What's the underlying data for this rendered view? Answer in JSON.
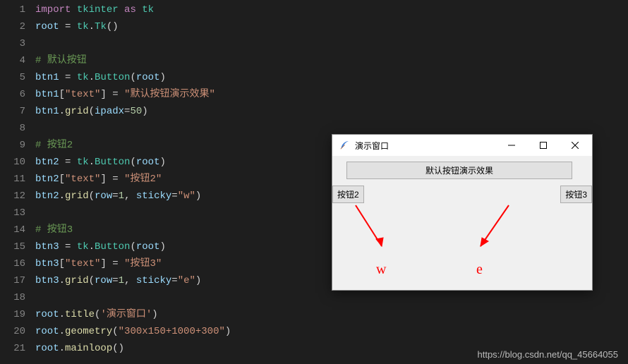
{
  "lines": [
    {
      "n": 1,
      "tokens": [
        [
          "kw",
          "import"
        ],
        [
          "op",
          " "
        ],
        [
          "mod",
          "tkinter"
        ],
        [
          "op",
          " "
        ],
        [
          "kw",
          "as"
        ],
        [
          "op",
          " "
        ],
        [
          "mod",
          "tk"
        ]
      ]
    },
    {
      "n": 2,
      "tokens": [
        [
          "var",
          "root"
        ],
        [
          "op",
          " = "
        ],
        [
          "mod",
          "tk"
        ],
        [
          "pn",
          "."
        ],
        [
          "fnc",
          "Tk"
        ],
        [
          "pn",
          "()"
        ]
      ]
    },
    {
      "n": 3,
      "tokens": []
    },
    {
      "n": 4,
      "tokens": [
        [
          "cmt",
          "# 默认按钮"
        ]
      ]
    },
    {
      "n": 5,
      "tokens": [
        [
          "var",
          "btn1"
        ],
        [
          "op",
          " = "
        ],
        [
          "mod",
          "tk"
        ],
        [
          "pn",
          "."
        ],
        [
          "fnc",
          "Button"
        ],
        [
          "pn",
          "("
        ],
        [
          "var",
          "root"
        ],
        [
          "pn",
          ")"
        ]
      ]
    },
    {
      "n": 6,
      "tokens": [
        [
          "var",
          "btn1"
        ],
        [
          "pn",
          "["
        ],
        [
          "str",
          "\"text\""
        ],
        [
          "pn",
          "]"
        ],
        [
          "op",
          " = "
        ],
        [
          "str",
          "\"默认按钮演示效果\""
        ]
      ]
    },
    {
      "n": 7,
      "tokens": [
        [
          "var",
          "btn1"
        ],
        [
          "pn",
          "."
        ],
        [
          "fn",
          "grid"
        ],
        [
          "pn",
          "("
        ],
        [
          "var",
          "ipadx"
        ],
        [
          "op",
          "="
        ],
        [
          "num",
          "50"
        ],
        [
          "pn",
          ")"
        ]
      ]
    },
    {
      "n": 8,
      "tokens": []
    },
    {
      "n": 9,
      "tokens": [
        [
          "cmt",
          "# 按钮2"
        ]
      ]
    },
    {
      "n": 10,
      "tokens": [
        [
          "var",
          "btn2"
        ],
        [
          "op",
          " = "
        ],
        [
          "mod",
          "tk"
        ],
        [
          "pn",
          "."
        ],
        [
          "fnc",
          "Button"
        ],
        [
          "pn",
          "("
        ],
        [
          "var",
          "root"
        ],
        [
          "pn",
          ")"
        ]
      ]
    },
    {
      "n": 11,
      "tokens": [
        [
          "var",
          "btn2"
        ],
        [
          "pn",
          "["
        ],
        [
          "str",
          "\"text\""
        ],
        [
          "pn",
          "]"
        ],
        [
          "op",
          " = "
        ],
        [
          "str",
          "\"按钮2\""
        ]
      ]
    },
    {
      "n": 12,
      "tokens": [
        [
          "var",
          "btn2"
        ],
        [
          "pn",
          "."
        ],
        [
          "fn",
          "grid"
        ],
        [
          "pn",
          "("
        ],
        [
          "var",
          "row"
        ],
        [
          "op",
          "="
        ],
        [
          "num",
          "1"
        ],
        [
          "pn",
          ", "
        ],
        [
          "var",
          "sticky"
        ],
        [
          "op",
          "="
        ],
        [
          "str",
          "\"w\""
        ],
        [
          "pn",
          ")"
        ]
      ]
    },
    {
      "n": 13,
      "tokens": []
    },
    {
      "n": 14,
      "tokens": [
        [
          "cmt",
          "# 按钮3"
        ]
      ]
    },
    {
      "n": 15,
      "tokens": [
        [
          "var",
          "btn3"
        ],
        [
          "op",
          " = "
        ],
        [
          "mod",
          "tk"
        ],
        [
          "pn",
          "."
        ],
        [
          "fnc",
          "Button"
        ],
        [
          "pn",
          "("
        ],
        [
          "var",
          "root"
        ],
        [
          "pn",
          ")"
        ]
      ]
    },
    {
      "n": 16,
      "tokens": [
        [
          "var",
          "btn3"
        ],
        [
          "pn",
          "["
        ],
        [
          "str",
          "\"text\""
        ],
        [
          "pn",
          "]"
        ],
        [
          "op",
          " = "
        ],
        [
          "str",
          "\"按钮3\""
        ]
      ]
    },
    {
      "n": 17,
      "tokens": [
        [
          "var",
          "btn3"
        ],
        [
          "pn",
          "."
        ],
        [
          "fn",
          "grid"
        ],
        [
          "pn",
          "("
        ],
        [
          "var",
          "row"
        ],
        [
          "op",
          "="
        ],
        [
          "num",
          "1"
        ],
        [
          "pn",
          ", "
        ],
        [
          "var",
          "sticky"
        ],
        [
          "op",
          "="
        ],
        [
          "str",
          "\"e\""
        ],
        [
          "pn",
          ")"
        ]
      ]
    },
    {
      "n": 18,
      "tokens": []
    },
    {
      "n": 19,
      "tokens": [
        [
          "var",
          "root"
        ],
        [
          "pn",
          "."
        ],
        [
          "fn",
          "title"
        ],
        [
          "pn",
          "("
        ],
        [
          "str",
          "'演示窗口'"
        ],
        [
          "pn",
          ")"
        ]
      ]
    },
    {
      "n": 20,
      "tokens": [
        [
          "var",
          "root"
        ],
        [
          "pn",
          "."
        ],
        [
          "fn",
          "geometry"
        ],
        [
          "pn",
          "("
        ],
        [
          "str",
          "\"300x150+1000+300\""
        ],
        [
          "pn",
          ")"
        ]
      ]
    },
    {
      "n": 21,
      "tokens": [
        [
          "var",
          "root"
        ],
        [
          "pn",
          "."
        ],
        [
          "fn",
          "mainloop"
        ],
        [
          "pn",
          "()"
        ]
      ]
    }
  ],
  "window": {
    "title": "演示窗口",
    "btn_wide": "默认按钮演示效果",
    "btn_w": "按钮2",
    "btn_e": "按钮3"
  },
  "annotations": {
    "w": "w",
    "e": "e"
  },
  "watermark": "https://blog.csdn.net/qq_45664055"
}
